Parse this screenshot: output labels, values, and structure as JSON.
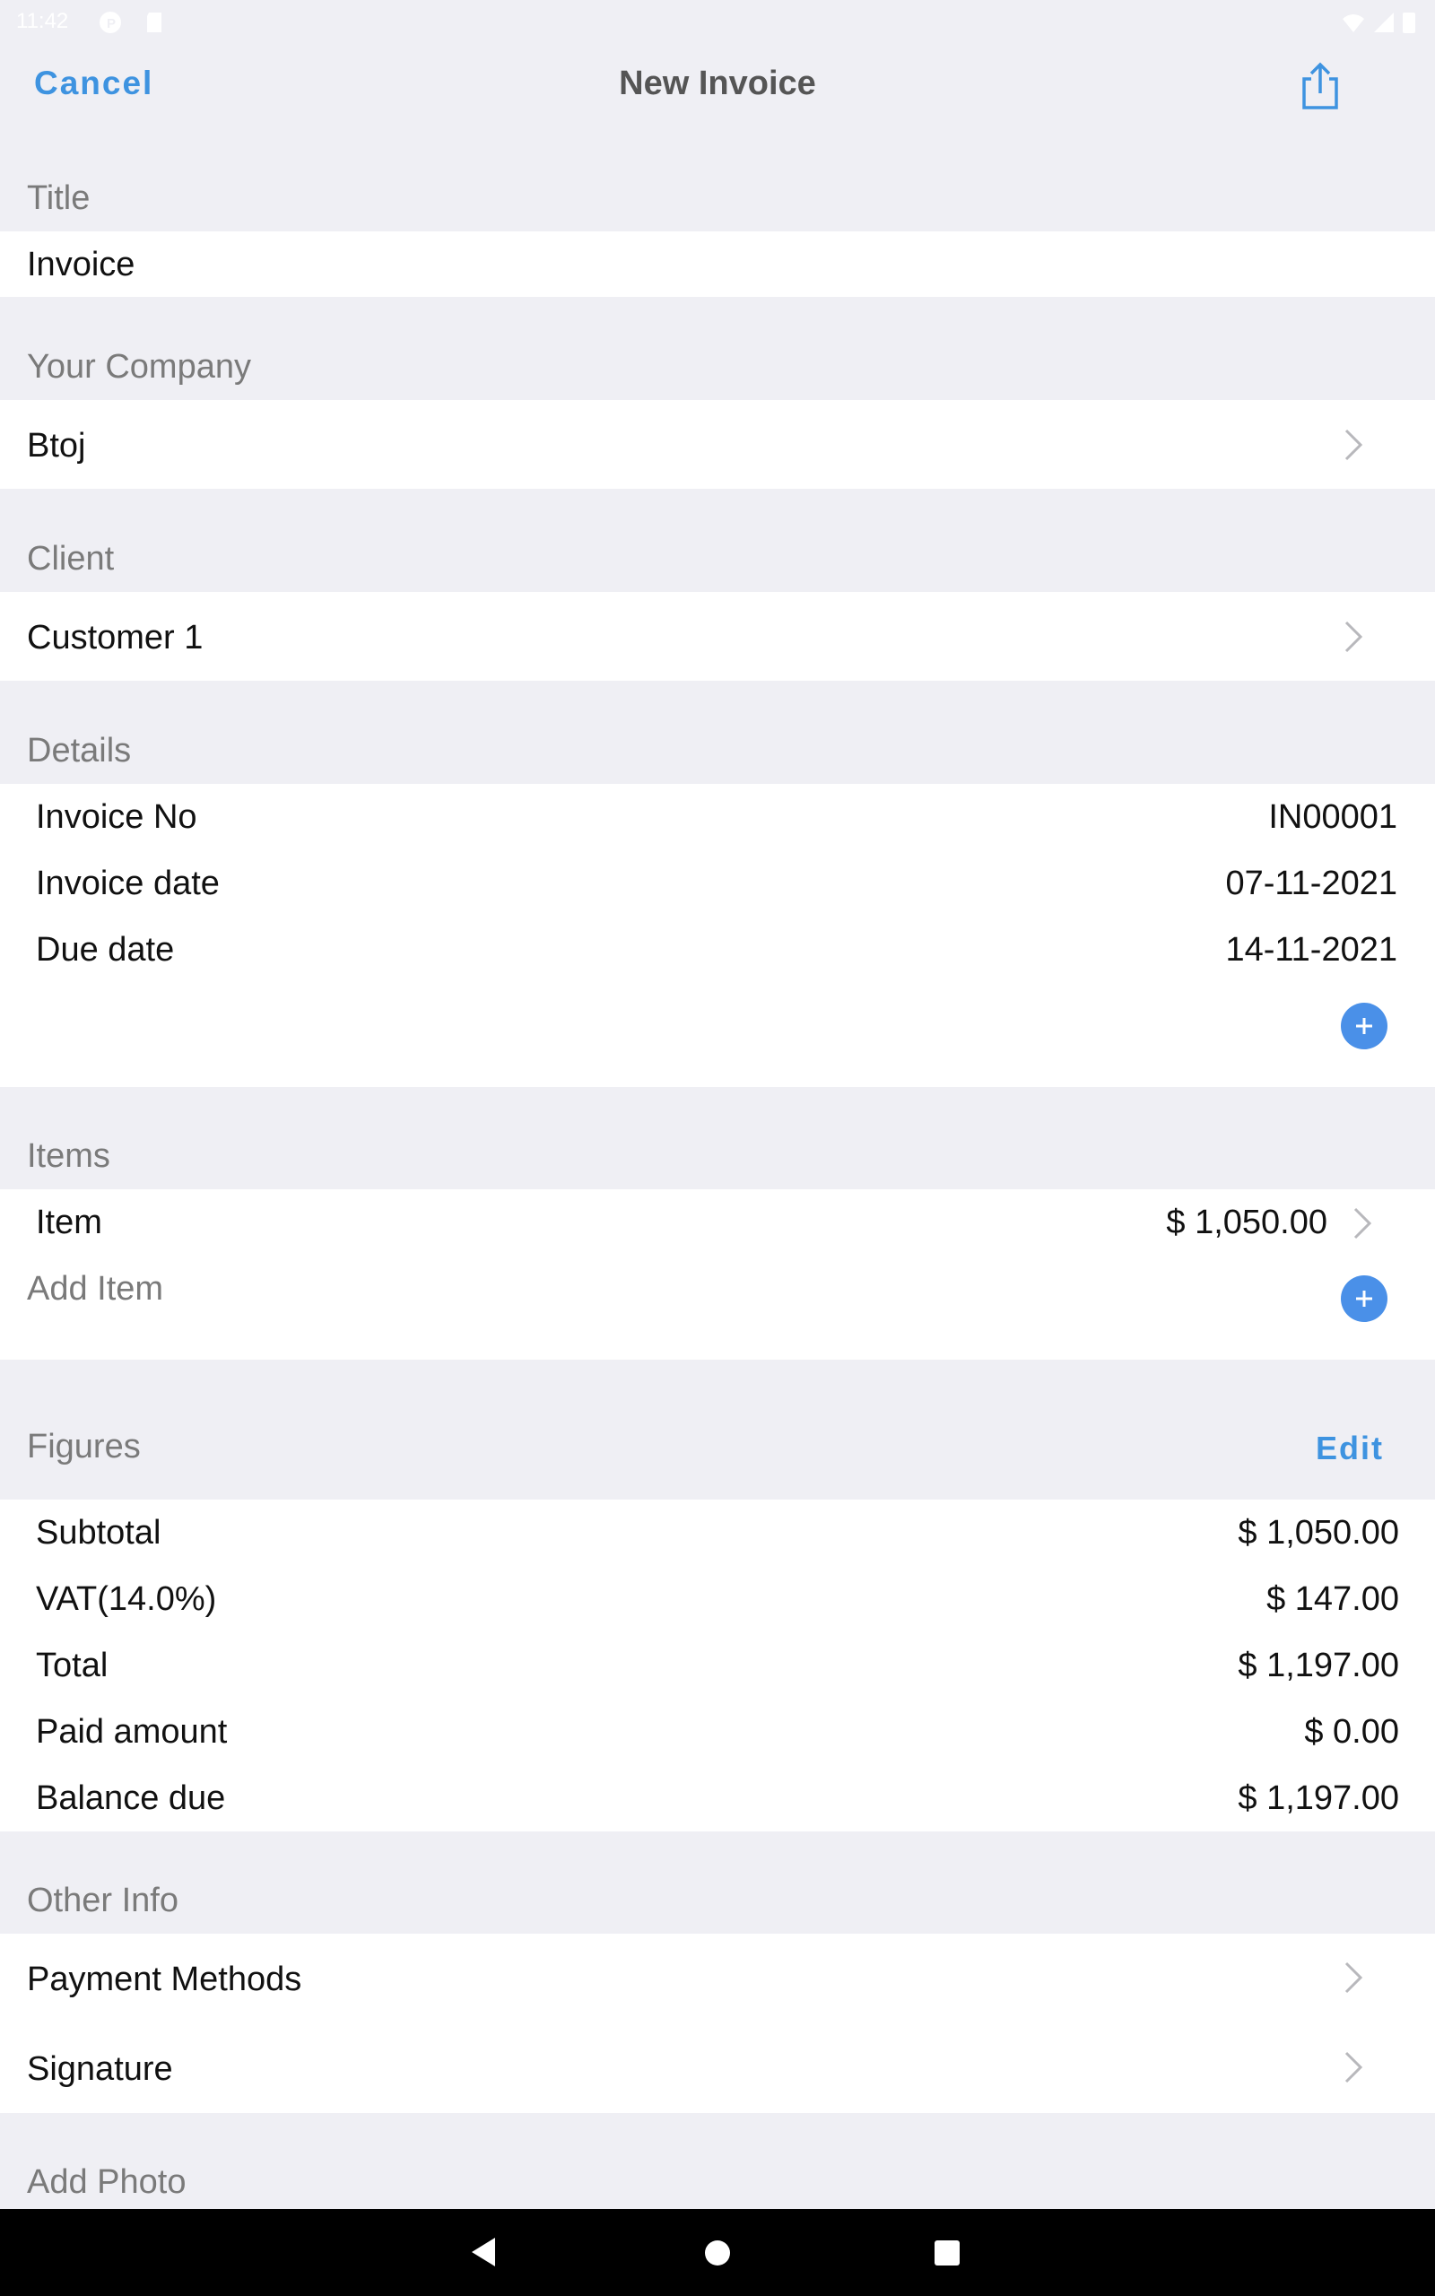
{
  "status_bar": {
    "time": "11:42",
    "icons": [
      "app-icon",
      "sd-card-icon",
      "wifi-icon",
      "signal-icon",
      "battery-icon"
    ]
  },
  "nav": {
    "cancel_label": "Cancel",
    "title": "New Invoice",
    "share_icon": "share-icon"
  },
  "title_section": {
    "header": "Title",
    "value": "Invoice"
  },
  "company_section": {
    "header": "Your Company",
    "value": "Btoj"
  },
  "client_section": {
    "header": "Client",
    "value": "Customer 1"
  },
  "details_section": {
    "header": "Details",
    "rows": [
      {
        "label": "Invoice No",
        "value": "IN00001"
      },
      {
        "label": "Invoice date",
        "value": "07-11-2021"
      },
      {
        "label": "Due date",
        "value": "14-11-2021"
      }
    ]
  },
  "items_section": {
    "header": "Items",
    "items": [
      {
        "label": "Item",
        "value": "$ 1,050.00"
      }
    ],
    "add_label": "Add Item"
  },
  "figures_section": {
    "header": "Figures",
    "edit_label": "Edit",
    "rows": [
      {
        "label": "Subtotal",
        "value": "$ 1,050.00"
      },
      {
        "label": "VAT(14.0%)",
        "value": "$ 147.00"
      },
      {
        "label": "Total",
        "value": "$ 1,197.00"
      },
      {
        "label": "Paid amount",
        "value": "$ 0.00"
      },
      {
        "label": "Balance due",
        "value": "$ 1,197.00"
      }
    ]
  },
  "other_section": {
    "header": "Other Info",
    "rows": [
      {
        "label": "Payment Methods"
      },
      {
        "label": "Signature"
      }
    ]
  },
  "photo_section": {
    "header": "Add Photo"
  },
  "system_nav": {
    "icons": [
      "back-icon",
      "home-icon",
      "recents-icon"
    ]
  },
  "colors": {
    "accent": "#3e93e0",
    "plus_button": "#4a90e8",
    "background": "#efeff4",
    "card": "#ffffff"
  }
}
